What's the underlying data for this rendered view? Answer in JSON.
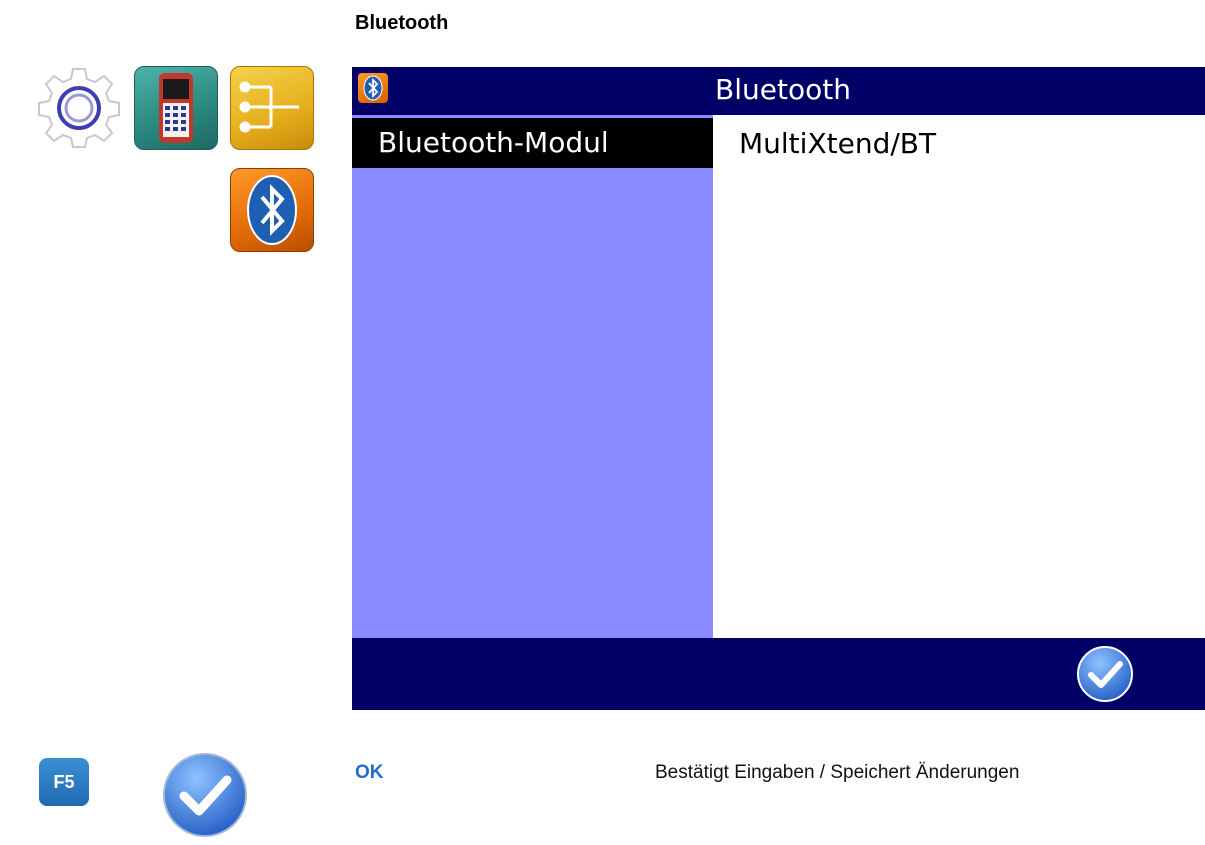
{
  "heading": "Bluetooth",
  "menu_icons": {
    "settings": "gear-icon",
    "device": "handheld-device-icon",
    "network": "network-tree-icon",
    "bluetooth": "bluetooth-icon"
  },
  "screen": {
    "title": "Bluetooth",
    "title_icon": "bluetooth-icon",
    "rows": [
      {
        "label": "Bluetooth-Modul",
        "value": "MultiXtend/BT",
        "selected": true
      }
    ],
    "footer_button": "ok-check-icon"
  },
  "legend": {
    "key": "F5",
    "icon": "ok-check-icon",
    "label": "OK",
    "description": "Bestätigt Eingaben / Speichert Änderungen"
  },
  "colors": {
    "titlebar": "#000066",
    "left_pane": "#8a8aff",
    "selected_row": "#000000",
    "ok_label": "#1f6fcf"
  }
}
